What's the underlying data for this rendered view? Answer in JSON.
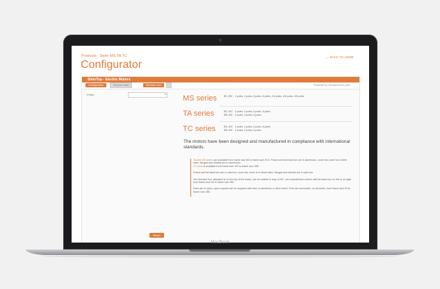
{
  "header": {
    "breadcrumb": "Products - Serie MS TA TC",
    "title": "Configurator",
    "back_label": "Back to home"
  },
  "panel": {
    "title": "SimoTop - Electric Motors",
    "tabs": [
      "Configurator",
      "Manual data",
      "Manual excl.",
      ""
    ],
    "powered_by": "Powered by Simoservices.com"
  },
  "filter": {
    "label": "Poles",
    "select_value": ""
  },
  "series": [
    {
      "name": "MS series",
      "codes": "IE1, IE2",
      "desc": "2 poles, 4 poles, 6 poles, 8 poles, 2/4 poles, 4/6 poles, 4/8 poles"
    },
    {
      "name": "TA series",
      "codes": "IE1, IE2\nIE3, IE4",
      "desc": "2 poles, 4 poles, 6 poles, 8 poles\n2 poles, 4 poles, 6 poles"
    },
    {
      "name": "TC series",
      "codes": "IE1, IE2\nIE3, IE4",
      "desc": "2 poles, 4 poles, 6 poles, 8 poles\n2 poles, 4 poles, 6 poles"
    }
  ],
  "intro": "The motors have been designed and manufactured in compliance with international standards.",
  "info": {
    "p1_highlight": "TA and MS series",
    "p1_text": " are available from frame size 56 to frame size 20.5. Frame and terminal box are in aluminium, cover fan cover is in sheet steel, flanges and shields are in aluminium.",
    "p1b_highlight": "TC serie",
    "p1b_text": " is available from frame size 132 to frame size 355.",
    "p2": "Frame and terminal box are in cast iron, cover fan cover is in sheet steel, flanges and shields are in cast iron.",
    "p3": "The terminal box, standard is on the top of the motor, can be rotated in step of 90°, can manufacture motors with terminal box on left or on right from frame size 63 to frame size 280.",
    "p4": "Fans are in nylon, upon request can be supplied with fans in aluminium or steel sheet. Feet are removable, on all series, from frame size 63 to frame size 280."
  },
  "reset_label": "Reset",
  "laptop_brand": "MacBook",
  "colors": {
    "accent": "#e07b39",
    "bezel": "#1c1c1e"
  }
}
